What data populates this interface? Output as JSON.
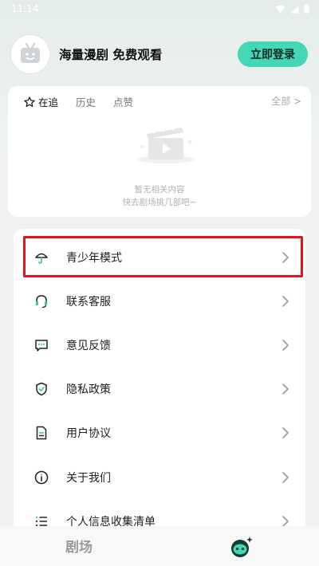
{
  "status_bar": {
    "time": "11:14"
  },
  "header": {
    "title": "海量漫剧 免费观看",
    "login_label": "立即登录"
  },
  "history": {
    "tabs": [
      {
        "label": "在追",
        "active": true
      },
      {
        "label": "历史",
        "active": false
      },
      {
        "label": "点赞",
        "active": false
      }
    ],
    "view_all": "全部 >",
    "empty_line1": "暂无相关内容",
    "empty_line2": "快去剧场挑几部吧~"
  },
  "menu": {
    "items": [
      {
        "label": "青少年模式",
        "icon": "umbrella-icon"
      },
      {
        "label": "联系客服",
        "icon": "headset-icon"
      },
      {
        "label": "意见反馈",
        "icon": "chat-icon"
      },
      {
        "label": "隐私政策",
        "icon": "shield-icon"
      },
      {
        "label": "用户协议",
        "icon": "document-icon"
      },
      {
        "label": "关于我们",
        "icon": "info-icon"
      },
      {
        "label": "个人信息收集清单",
        "icon": "list-icon"
      }
    ]
  },
  "bottom_nav": {
    "theater_label": "剧场"
  },
  "colors": {
    "accent": "#44d7b6",
    "highlight": "#e0151f"
  }
}
